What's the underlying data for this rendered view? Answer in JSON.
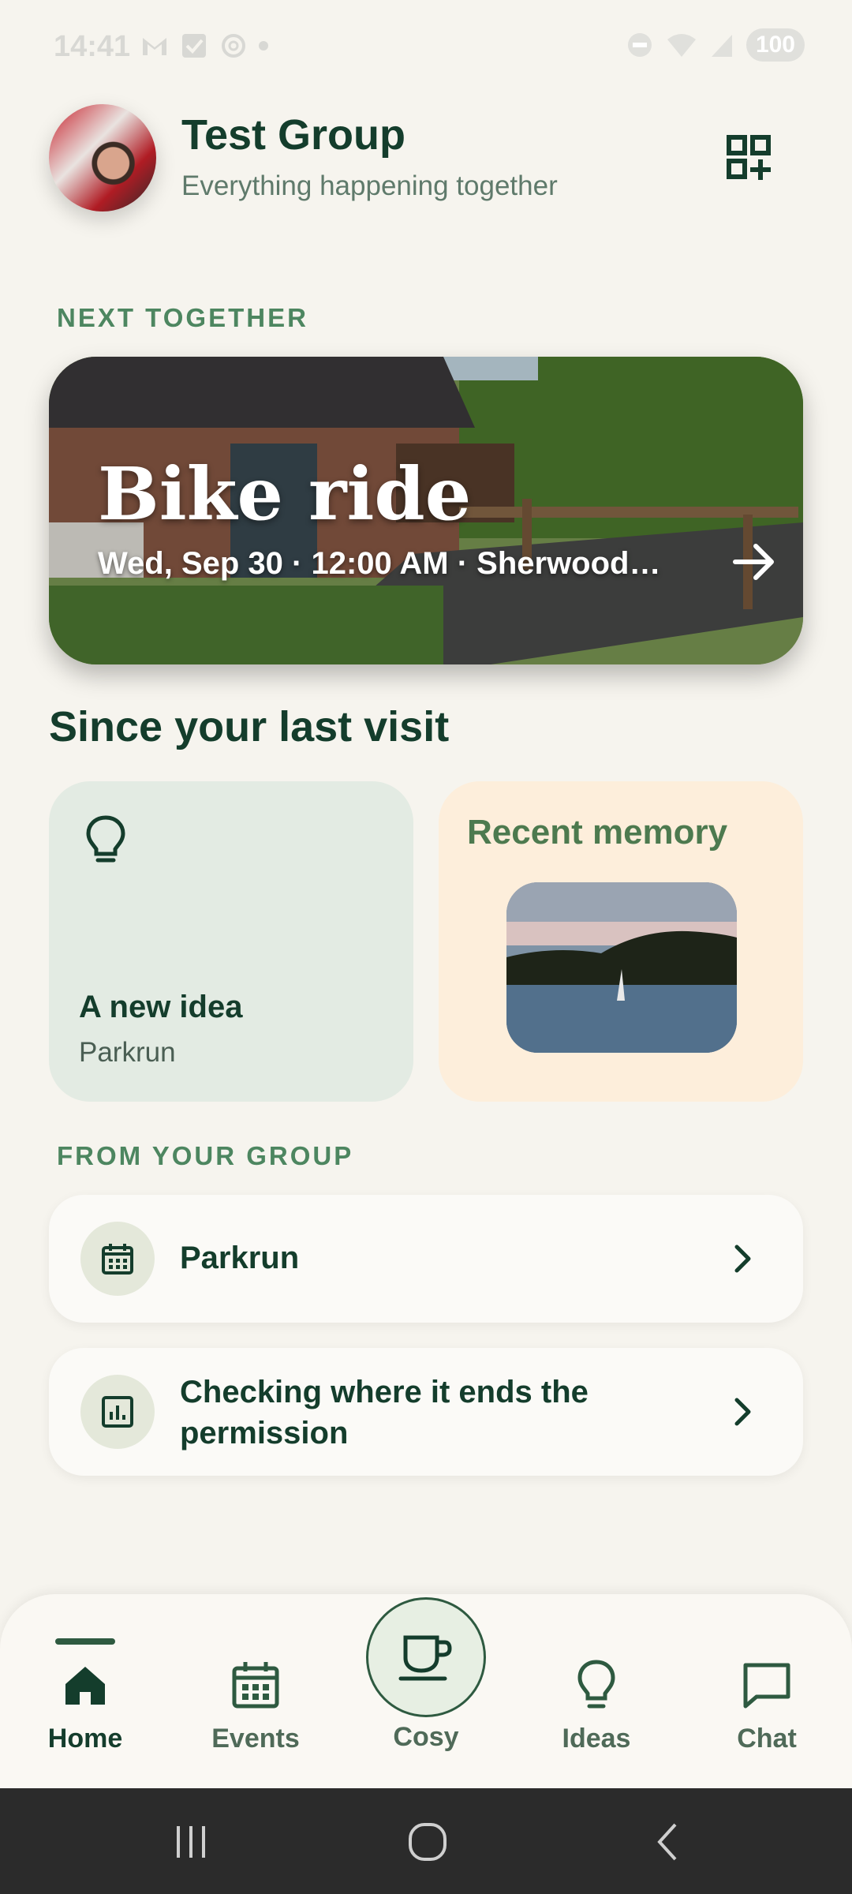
{
  "status_bar": {
    "time": "14:41",
    "battery": "100"
  },
  "header": {
    "title": "Test Group",
    "subtitle": "Everything happening together"
  },
  "next_together": {
    "label": "NEXT TOGETHER",
    "event_title": "Bike ride",
    "event_meta": "Wed, Sep 30 · 12:00 AM · Sherwood…"
  },
  "since_last_visit": {
    "title": "Since your last visit",
    "idea_card": {
      "title": "A new idea",
      "subtitle": "Parkrun"
    },
    "memory_card": {
      "title": "Recent memory"
    }
  },
  "from_group": {
    "label": "FROM YOUR GROUP",
    "items": [
      {
        "text": "Parkrun",
        "icon": "calendar-icon"
      },
      {
        "line1": "Checking where it ends the",
        "line2": "permission",
        "icon": "poll-icon"
      }
    ]
  },
  "nav": {
    "home": "Home",
    "events": "Events",
    "cosy": "Cosy",
    "ideas": "Ideas",
    "chat": "Chat",
    "active": "Home"
  },
  "colors": {
    "primary": "#143d2c",
    "accent": "#4d8660",
    "background": "#f6f4ee"
  }
}
